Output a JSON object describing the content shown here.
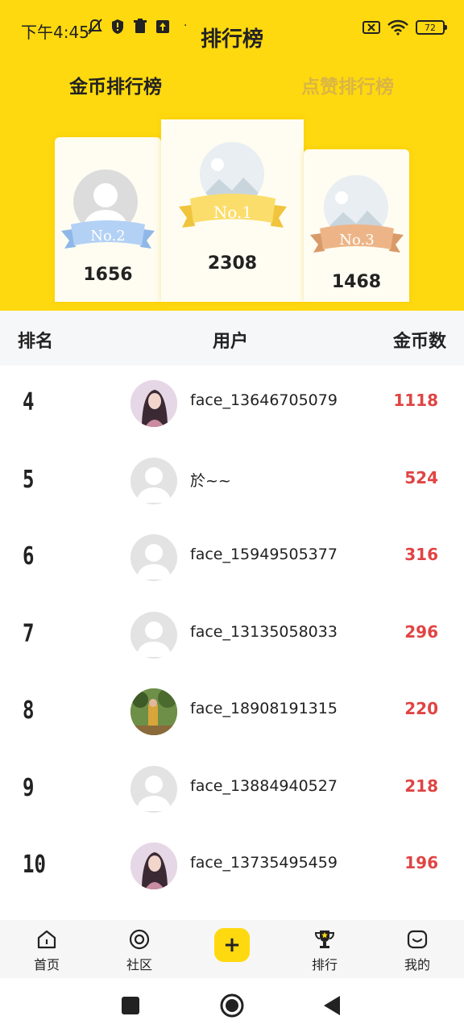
{
  "status": {
    "time": "下午4:45",
    "battery": "72"
  },
  "header": {
    "title": "排行榜",
    "tabs": [
      {
        "label": "金币排行榜",
        "active": true
      },
      {
        "label": "点赞排行榜",
        "active": false
      }
    ]
  },
  "podium": {
    "second": {
      "badge": "No.2",
      "score": "1656"
    },
    "first": {
      "badge": "No.1",
      "score": "2308"
    },
    "third": {
      "badge": "No.3",
      "score": "1468"
    }
  },
  "table": {
    "col_rank": "排名",
    "col_user": "用户",
    "col_coins": "金币数"
  },
  "rows": [
    {
      "rank": "4",
      "name": "face_13646705079",
      "coins": "1118",
      "avatar": "photo-woman"
    },
    {
      "rank": "5",
      "name": "於~~",
      "coins": "524",
      "avatar": "default"
    },
    {
      "rank": "6",
      "name": "face_15949505377",
      "coins": "316",
      "avatar": "default"
    },
    {
      "rank": "7",
      "name": "face_13135058033",
      "coins": "296",
      "avatar": "default"
    },
    {
      "rank": "8",
      "name": "face_18908191315",
      "coins": "220",
      "avatar": "photo-outdoor"
    },
    {
      "rank": "9",
      "name": "face_13884940527",
      "coins": "218",
      "avatar": "default"
    },
    {
      "rank": "10",
      "name": "face_13735495459",
      "coins": "196",
      "avatar": "photo-woman"
    }
  ],
  "bottom_nav": {
    "home": "首页",
    "community": "社区",
    "plus": "+",
    "rank": "排行",
    "mine": "我的"
  },
  "colors": {
    "accent": "#FFD90F",
    "coins": "#E04444"
  }
}
